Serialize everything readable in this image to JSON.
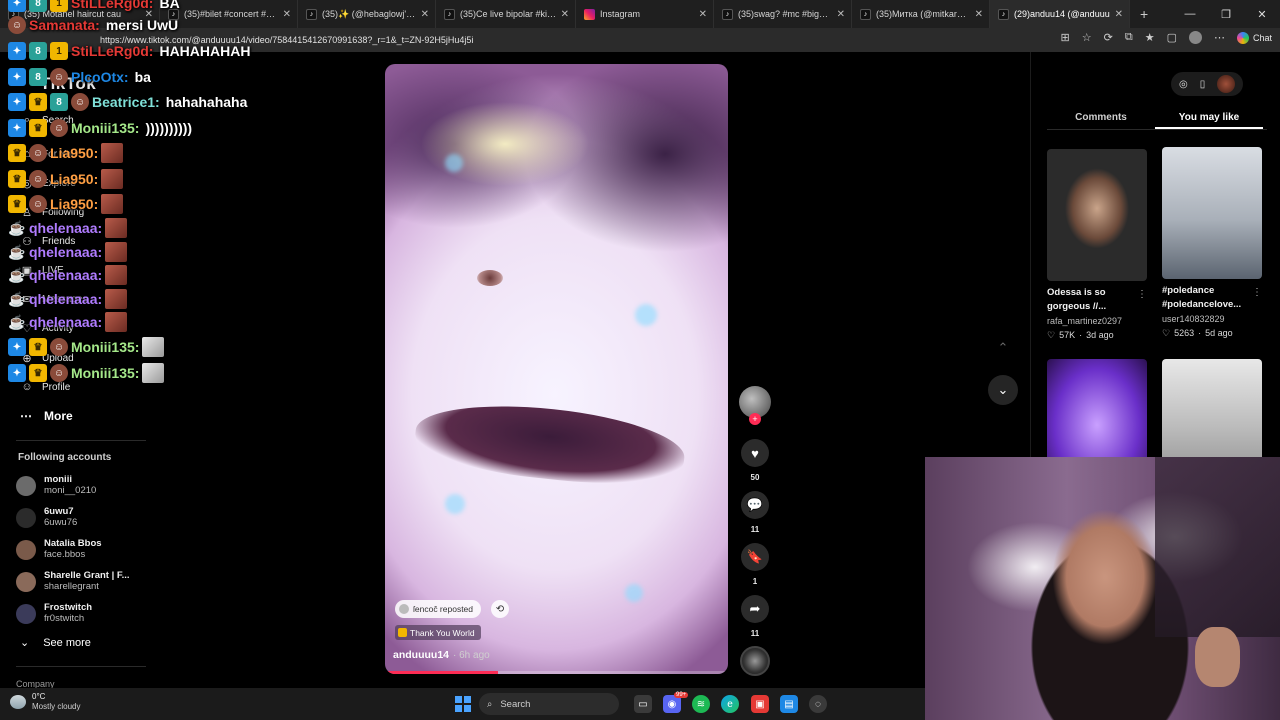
{
  "browser": {
    "tabs": [
      {
        "label": "(35) Motanel haircut cau",
        "icon": "tiktok-icon"
      },
      {
        "label": "(35)#bilet #concert #1992 #",
        "icon": "tiktok-icon"
      },
      {
        "label": "(35)✨ (@hebaglowj's) videc",
        "icon": "tiktok-icon"
      },
      {
        "label": "(35)Ce live bipolar #kickstre",
        "icon": "tiktok-icon"
      },
      {
        "label": "Instagram",
        "icon": "instagram-icon"
      },
      {
        "label": "(35)swag? #mc #bigmac #u",
        "icon": "tiktok-icon"
      },
      {
        "label": "(35)Митка (@mitkarangelov",
        "icon": "tiktok-icon"
      },
      {
        "label": "(29)anduu14 (@anduuu",
        "icon": "tiktok-icon"
      }
    ],
    "url": "https://www.tiktok.com/@anduuuu14/video/7584415412670991638?_r=1&_t=ZN-92H5jHu4j5i",
    "chat_label": "Chat"
  },
  "nav": {
    "brand": "TikTok",
    "items": [
      "Search",
      "For You",
      "Explore",
      "Following",
      "Friends",
      "LIVE",
      "Messages",
      "Activity",
      "Upload",
      "Profile"
    ],
    "more": "More",
    "following_title": "Following accounts",
    "accounts": [
      {
        "name": "moniii",
        "handle": "moni__0210"
      },
      {
        "name": "6uwu7",
        "handle": "6uwu76"
      },
      {
        "name": "Natalia Bbos",
        "handle": "face.bbos"
      },
      {
        "name": "Sharelle Grant | F...",
        "handle": "sharellegrant"
      },
      {
        "name": "Frostwitch",
        "handle": "fr0stwitch"
      }
    ],
    "see_more": "See more",
    "company": "Company"
  },
  "chat": {
    "messages": [
      {
        "user": "StiLLeRg0d:",
        "text": "BA",
        "color": "#e53935"
      },
      {
        "user": "Samanata:",
        "text": "mersi UwU",
        "color": "#e53935"
      },
      {
        "user": "StiLLeRg0d:",
        "text": "HAHAHAHAH",
        "color": "#e53935"
      },
      {
        "user": "PlcoOtx:",
        "text": "ba",
        "color": "#1e88e5"
      },
      {
        "user": "Beatrice1:",
        "text": "hahahahaha",
        "color": "#7fe0d8"
      },
      {
        "user": "Moniii135:",
        "text": "))))))))))",
        "color": "#a5e88a"
      },
      {
        "user": "Lia950:",
        "text": "",
        "color": "#ff9f43"
      },
      {
        "user": "Lia950:",
        "text": "",
        "color": "#ff9f43"
      },
      {
        "user": "Lia950:",
        "text": "",
        "color": "#ff9f43"
      },
      {
        "user": "qhelenaaa:",
        "text": "",
        "color": "#b07cff"
      },
      {
        "user": "qhelenaaa:",
        "text": "",
        "color": "#b07cff"
      },
      {
        "user": "qhelenaaa:",
        "text": "",
        "color": "#b07cff"
      },
      {
        "user": "qhelenaaa:",
        "text": "",
        "color": "#b07cff"
      },
      {
        "user": "qhelenaaa:",
        "text": "",
        "color": "#b07cff"
      },
      {
        "user": "Moniii135:",
        "text": "",
        "color": "#a5e88a"
      },
      {
        "user": "Moniii135:",
        "text": "",
        "color": "#a5e88a"
      }
    ]
  },
  "video": {
    "repost_label": "ſencoĉ reposted",
    "sound": "Thank You World",
    "author": "anduuuu14",
    "time": "· 6h ago",
    "progress": 0.33,
    "likes": "50",
    "comments": "11",
    "saves": "1",
    "shares": "11"
  },
  "right_panel": {
    "tabs": [
      "Comments",
      "You may like"
    ],
    "active_tab": "You may like",
    "cards": [
      {
        "title": "Odessa is so gorgeous //...",
        "user": "rafa_martinez0297",
        "likes": "57K",
        "age": "3d ago"
      },
      {
        "title": "#poledance #poledancelove...",
        "user": "user140832829",
        "likes": "5263",
        "age": "5d ago"
      },
      {
        "title": "",
        "user": "",
        "likes": "",
        "age": ""
      },
      {
        "title": "",
        "user": "",
        "likes": "",
        "age": ""
      }
    ]
  },
  "taskbar": {
    "temp": "0°C",
    "condition": "Mostly cloudy",
    "search": "Search",
    "discord_badge": "99+"
  },
  "colors": {
    "tiktok_red": "#fe2c55",
    "background": "#000000"
  }
}
